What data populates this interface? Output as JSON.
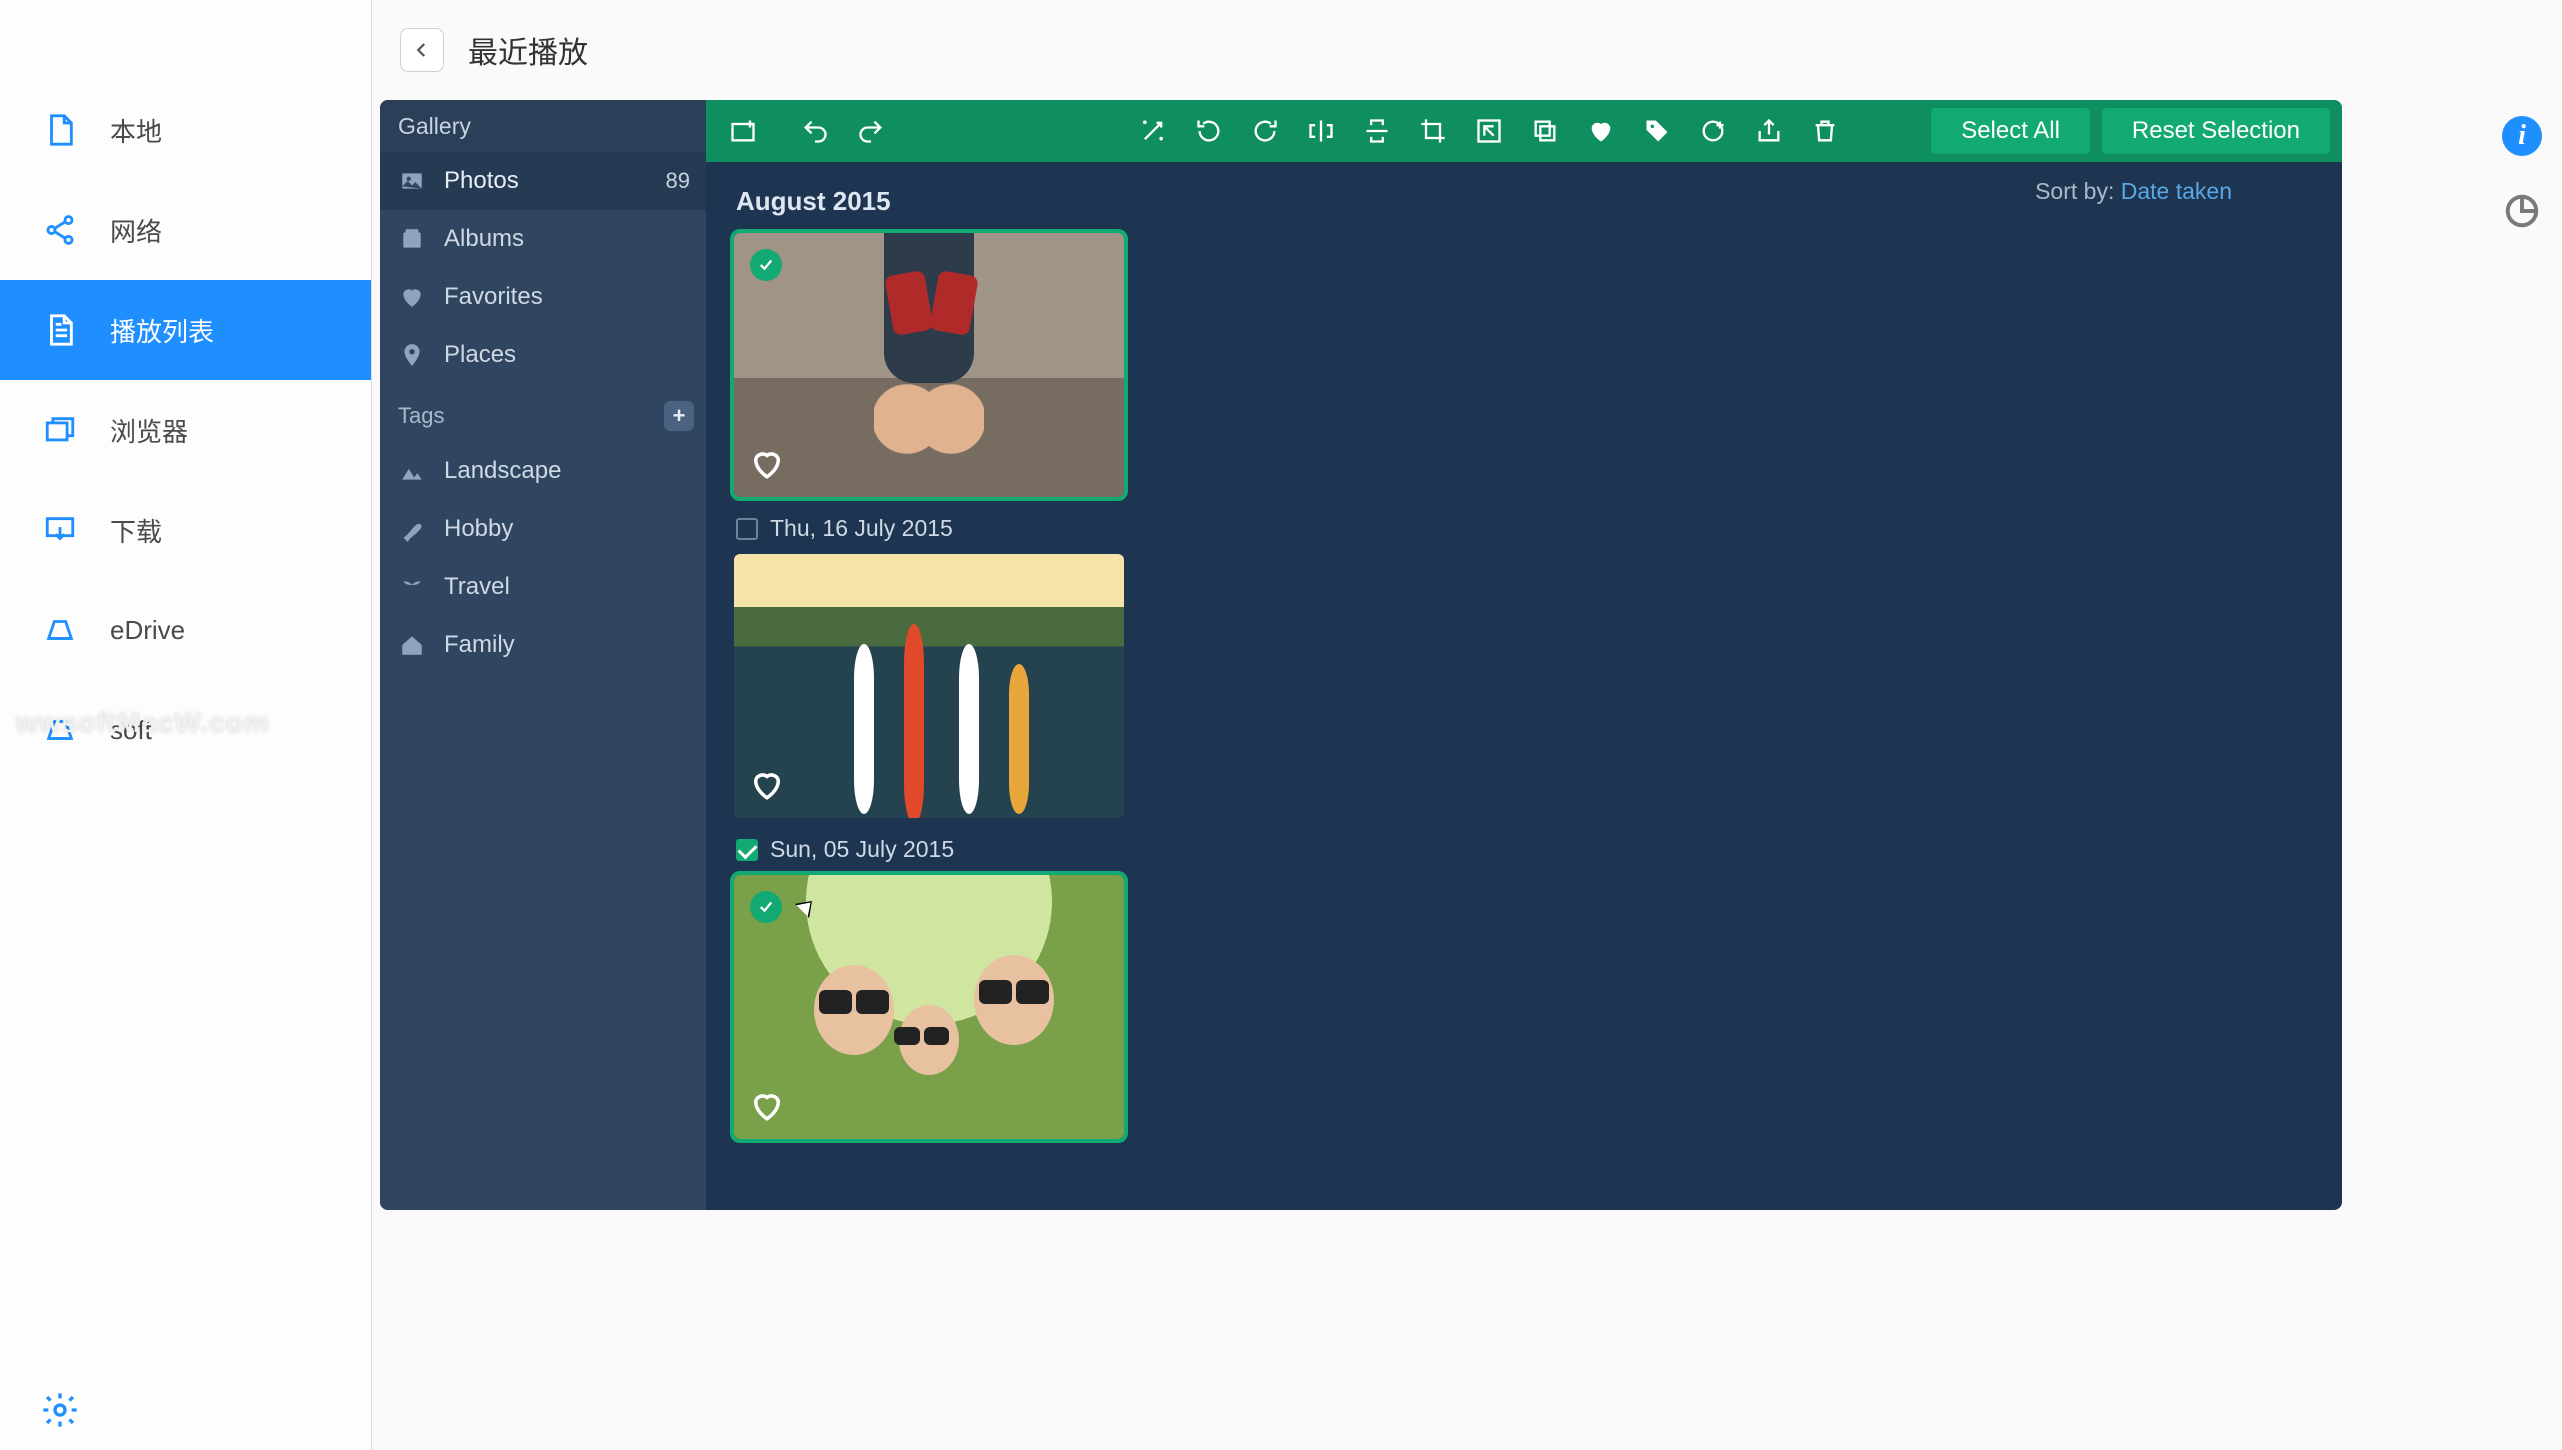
{
  "app": {
    "title": "最近播放"
  },
  "sidebar": {
    "items": [
      {
        "label": "本地"
      },
      {
        "label": "网络"
      },
      {
        "label": "播放列表"
      },
      {
        "label": "浏览器"
      },
      {
        "label": "下载"
      },
      {
        "label": "eDrive"
      },
      {
        "label": "soft"
      }
    ],
    "active_index": 2
  },
  "watermark": "wwsoftMacW.com",
  "gallery": {
    "header": "Gallery",
    "sections": [
      {
        "label": "Photos",
        "count": 89
      },
      {
        "label": "Albums"
      },
      {
        "label": "Favorites"
      },
      {
        "label": "Places"
      }
    ],
    "active_index": 0,
    "tags_header": "Tags",
    "tags": [
      {
        "label": "Landscape"
      },
      {
        "label": "Hobby"
      },
      {
        "label": "Travel"
      },
      {
        "label": "Family"
      }
    ]
  },
  "toolbar": {
    "select_all": "Select All",
    "reset_selection": "Reset Selection"
  },
  "content": {
    "sort_label": "Sort by:",
    "sort_value": "Date taken",
    "group": "August 2015",
    "dates": [
      {
        "label": "Thu, 16 July 2015",
        "checked": false
      },
      {
        "label": "Sun, 05 July 2015",
        "checked": true
      }
    ],
    "photos": [
      {
        "selected": true,
        "favorited": false
      },
      {
        "selected": false,
        "favorited": false
      },
      {
        "selected": true,
        "favorited": false
      }
    ]
  }
}
